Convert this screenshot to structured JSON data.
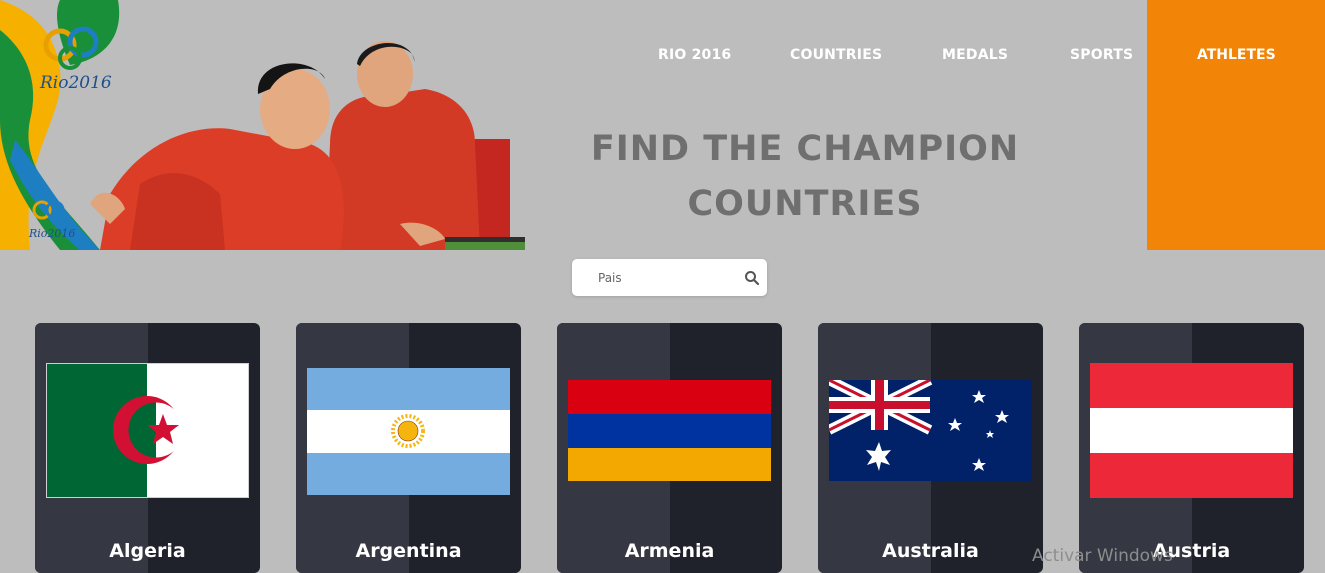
{
  "brand": {
    "logo_text": "Rio2016",
    "small_logo_text": "Rio2016"
  },
  "nav": {
    "items": [
      "RIO 2016",
      "COUNTRIES",
      "MEDALS",
      "SPORTS"
    ],
    "active": "ATHLETES",
    "active_color": "#f28507"
  },
  "hero": {
    "title_line1": "FIND THE CHAMPION",
    "title_line2": "COUNTRIES"
  },
  "search": {
    "placeholder": "Pais",
    "icon": "search-icon"
  },
  "countries": [
    {
      "name": "Algeria"
    },
    {
      "name": "Argentina"
    },
    {
      "name": "Armenia"
    },
    {
      "name": "Australia"
    },
    {
      "name": "Austria"
    }
  ],
  "watermark": "Activar Windows"
}
